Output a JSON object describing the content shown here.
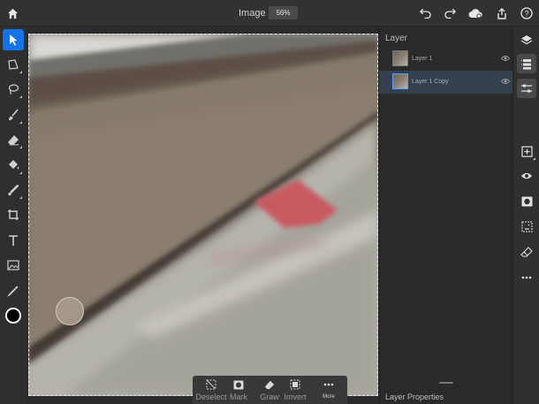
{
  "header": {
    "title": "Image",
    "zoom": "56%",
    "icons": [
      "home-icon",
      "undo-icon",
      "redo-icon",
      "cloud-icon",
      "share-icon",
      "help-icon"
    ]
  },
  "toolbar": {
    "tools": [
      "select-arrow-icon",
      "transform-icon",
      "lasso-icon",
      "brush-icon",
      "eraser-icon",
      "fill-bucket-icon",
      "healing-brush-icon",
      "crop-icon",
      "text-icon",
      "image-icon",
      "eyedropper-icon"
    ],
    "active_tool": "select-arrow-icon",
    "foreground_color": "#000000",
    "background_color": "#ffffff"
  },
  "actions": [
    {
      "label": "Deselect",
      "icon": "deselect-icon"
    },
    {
      "label": "Mark",
      "icon": "mask-icon"
    },
    {
      "label": "Graw",
      "icon": "eraser-icon"
    },
    {
      "label": "Imvert",
      "icon": "invert-icon"
    },
    {
      "label": "More",
      "icon": "more-icon"
    }
  ],
  "layers": {
    "title": "Layer",
    "items": [
      {
        "name": "Layer 1",
        "selected": false
      },
      {
        "name": "Layer 1 Copy",
        "selected": true
      }
    ],
    "properties_title": "Layer Properties"
  },
  "rail": {
    "icons": [
      "layers-icon",
      "layer-stack-icon",
      "adjustments-icon",
      "add-layer-icon",
      "visibility-icon",
      "mask-icon",
      "fx-icon",
      "erase-layer-icon",
      "more-icon"
    ],
    "accent": "#1473e6"
  }
}
